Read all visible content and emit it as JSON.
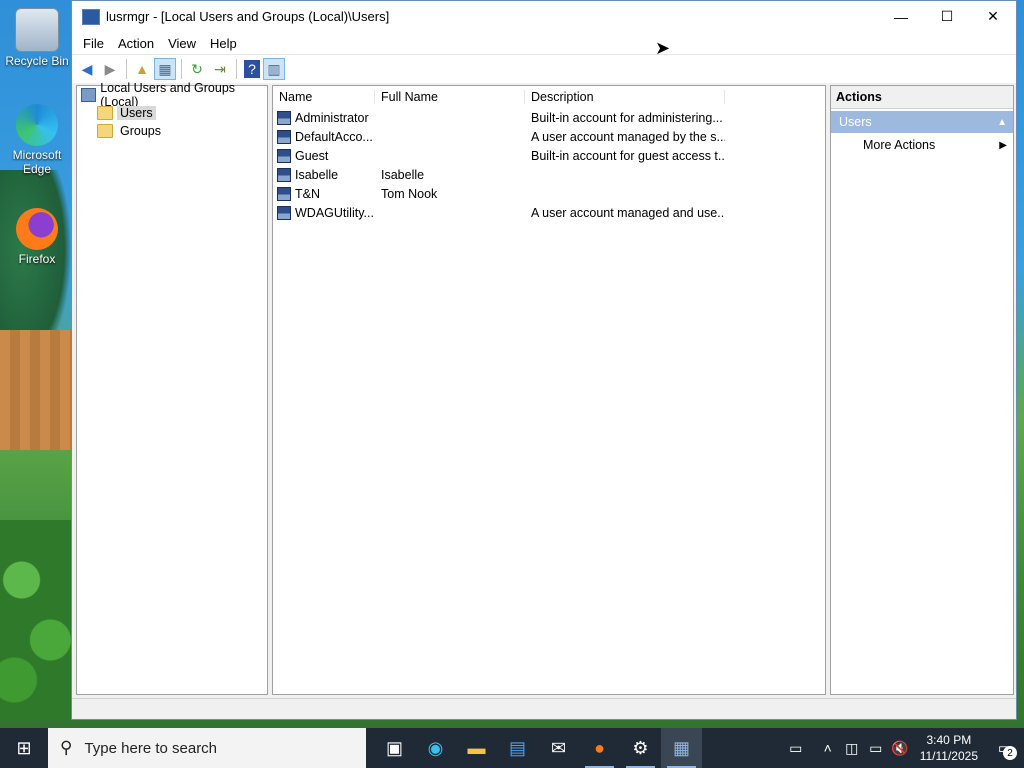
{
  "desktop": {
    "icons": [
      {
        "label": "Recycle Bin"
      },
      {
        "label": "Microsoft Edge"
      },
      {
        "label": "Firefox"
      }
    ]
  },
  "window": {
    "title": "lusrmgr - [Local Users and Groups (Local)\\Users]",
    "controls": {
      "minimize": "—",
      "maximize": "☐",
      "close": "✕"
    }
  },
  "menubar": {
    "items": [
      "File",
      "Action",
      "View",
      "Help"
    ]
  },
  "tree": {
    "root": "Local Users and Groups (Local)",
    "children": [
      "Users",
      "Groups"
    ],
    "selected": "Users"
  },
  "list": {
    "columns": [
      "Name",
      "Full Name",
      "Description"
    ],
    "rows": [
      {
        "name": "Administrator",
        "full_name": "",
        "description": "Built-in account for administering..."
      },
      {
        "name": "DefaultAcco...",
        "full_name": "",
        "description": "A user account managed by the s..."
      },
      {
        "name": "Guest",
        "full_name": "",
        "description": "Built-in account for guest access t..."
      },
      {
        "name": "Isabelle",
        "full_name": "Isabelle",
        "description": ""
      },
      {
        "name": "T&N",
        "full_name": "Tom Nook",
        "description": ""
      },
      {
        "name": "WDAGUtility...",
        "full_name": "",
        "description": "A user account managed and use..."
      }
    ]
  },
  "actions": {
    "header": "Actions",
    "section": "Users",
    "items": [
      "More Actions"
    ]
  },
  "taskbar": {
    "search_placeholder": "Type here to search",
    "time": "3:40 PM",
    "date": "11/11/2025",
    "notification_count": "2"
  },
  "colors": {
    "selection": "#9db9dd",
    "taskbar": "#1f2a36"
  }
}
